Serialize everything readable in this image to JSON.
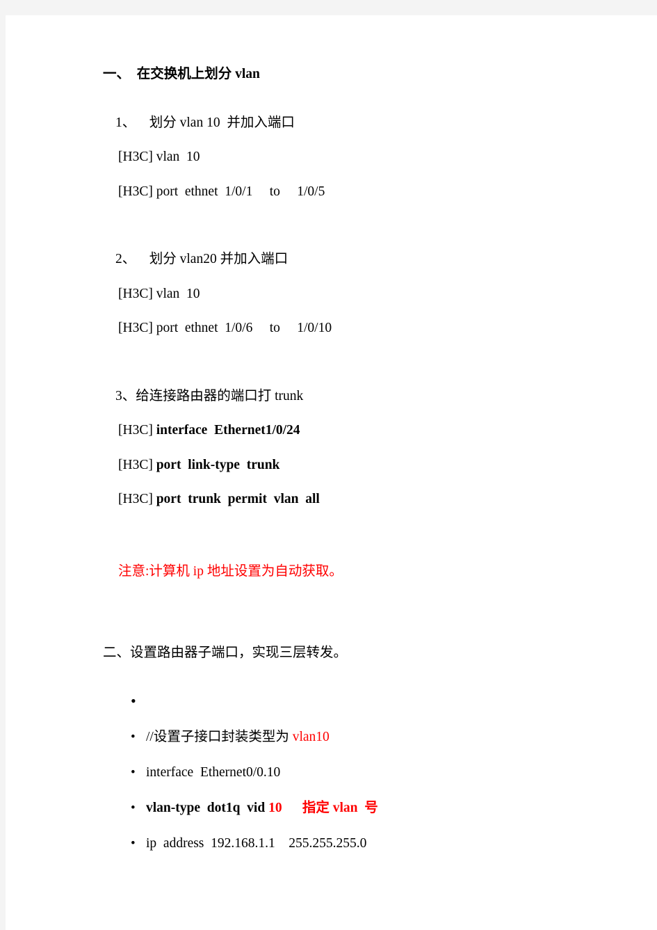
{
  "document": {
    "sections": [
      {
        "heading": "一、  在交换机上划分 vlan",
        "items": [
          {
            "label": "1、    划分 vlan 10  并加入端口"
          },
          {
            "prompt": "[H3C]",
            "command": " vlan  10"
          },
          {
            "prompt": "[H3C]",
            "command": " port  ethnet  1/0/1     to     1/0/5"
          },
          {
            "label": "2、    划分 vlan20 并加入端口"
          },
          {
            "prompt": "[H3C]",
            "command": " vlan  10"
          },
          {
            "prompt": "[H3C]",
            "command": " port  ethnet  1/0/6     to     1/0/10"
          },
          {
            "label": "3、给连接路由器的端口打 trunk"
          },
          {
            "prompt": "[H3C]",
            "command": " interface  Ethernet1/0/24"
          },
          {
            "prompt": "[H3C]",
            "command": " port  link-type  trunk"
          },
          {
            "prompt": "[H3C]",
            "command": " port  trunk  permit  vlan  all"
          }
        ],
        "note": "注意:计算机 ip 地址设置为自动获取。"
      },
      {
        "heading": "二、设置路由器子端口，实现三层转发。",
        "bullets": [
          {
            "text": ""
          },
          {
            "pre": "//设置子接口封装类型为 ",
            "red": "vlan10",
            "post": ""
          },
          {
            "pre": "interface  Ethernet0/0.10",
            "red": "",
            "post": ""
          },
          {
            "pre": "vlan-type  dot1q  vid ",
            "red": "10",
            "post": "      指定 vlan  号"
          },
          {
            "pre": "ip  address  192.168.1.1    255.255.255.0",
            "red": "",
            "post": ""
          }
        ]
      }
    ]
  },
  "colors": {
    "page_background": "#ffffff",
    "canvas_background": "#f4f4f4",
    "text": "#000000",
    "accent_red": "#ff0000"
  }
}
